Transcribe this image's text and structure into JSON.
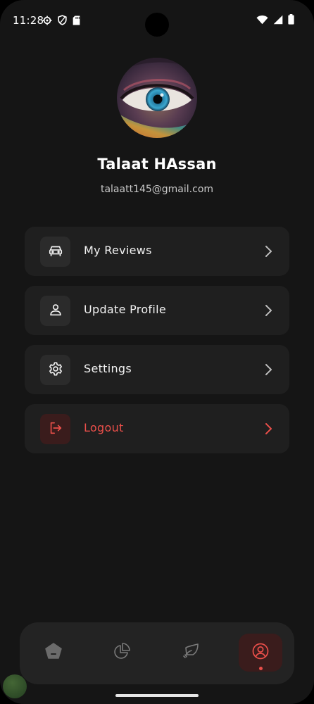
{
  "status_bar": {
    "time": "11:28",
    "icons_left": [
      "gear-icon",
      "shield-icon",
      "sd-card-icon"
    ],
    "icons_right": [
      "wifi-icon",
      "signal-icon",
      "battery-icon"
    ]
  },
  "profile": {
    "name": "Talaat HAssan",
    "email": "talaatt145@gmail.com",
    "avatar": "eye-photo"
  },
  "menu": {
    "items": [
      {
        "label": "My Reviews",
        "icon": "car-icon",
        "danger": false
      },
      {
        "label": "Update Profile",
        "icon": "user-icon",
        "danger": false
      },
      {
        "label": "Settings",
        "icon": "gear-icon",
        "danger": false
      },
      {
        "label": "Logout",
        "icon": "logout-icon",
        "danger": true
      }
    ]
  },
  "bottom_nav": {
    "items": [
      {
        "icon": "home-icon",
        "active": false
      },
      {
        "icon": "pie-chart-icon",
        "active": false
      },
      {
        "icon": "hand-icon",
        "active": false
      },
      {
        "icon": "profile-icon",
        "active": true
      }
    ]
  },
  "colors": {
    "background": "#151515",
    "card": "#1f1f1f",
    "accent": "#ea4f4a",
    "text": "#ffffff"
  }
}
